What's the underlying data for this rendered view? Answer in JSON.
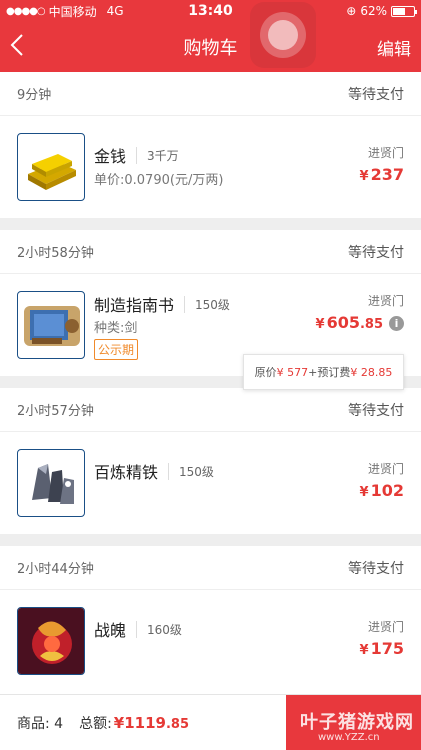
{
  "status_bar": {
    "carrier": "中国移动",
    "network": "4G",
    "time": "13:40",
    "battery": "62%",
    "battery_level": 0.62
  },
  "nav": {
    "back_icon": "chevron-left-icon",
    "title": "购物车",
    "edit": "编辑"
  },
  "orders": [
    {
      "time": "9分钟",
      "status": "等待支付",
      "name": "金钱",
      "level": "3千万",
      "sub": "单价:0.0790(元/万两)",
      "shop": "进贤门",
      "price_int": "237",
      "price_dec": "",
      "icon": "gold-bars-icon"
    },
    {
      "time": "2小时58分钟",
      "status": "等待支付",
      "name": "制造指南书",
      "level": "150级",
      "sub": "种类:剑",
      "tag": "公示期",
      "shop": "进贤门",
      "price_int": "605",
      "price_dec": ".85",
      "icon": "scroll-book-icon"
    },
    {
      "time": "2小时57分钟",
      "status": "等待支付",
      "name": "百炼精铁",
      "level": "150级",
      "shop": "进贤门",
      "price_int": "102",
      "price_dec": "",
      "icon": "iron-ore-icon"
    },
    {
      "time": "2小时44分钟",
      "status": "等待支付",
      "name": "战魄",
      "level": "160级",
      "shop": "进贤门",
      "price_int": "175",
      "price_dec": "",
      "icon": "war-spirit-icon"
    }
  ],
  "tooltip": {
    "orig_label": "原价",
    "orig_price": "¥ 577",
    "fee_label": "+预订费",
    "fee_price": "¥ 28.85"
  },
  "footer": {
    "items_label": "商品: 4",
    "total_label": "总额:",
    "total_int": "1119",
    "total_dec": ".85"
  },
  "watermark": {
    "text": "叶子猪游戏网",
    "url": "www.YZZ.cn"
  },
  "colors": {
    "brand_red": "#e8383d",
    "price_red": "#e53935",
    "tag_orange": "#f08a2b"
  }
}
